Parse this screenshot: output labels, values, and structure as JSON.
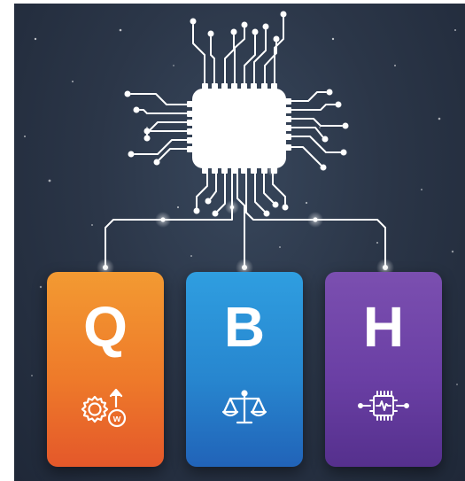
{
  "cards": [
    {
      "letter": "Q",
      "icon": "gear-upload-w-icon",
      "color": "#ee7a2a"
    },
    {
      "letter": "B",
      "icon": "balance-scale-icon",
      "color": "#2786cf"
    },
    {
      "letter": "H",
      "icon": "chip-pulse-icon",
      "color": "#6a3fa4"
    }
  ],
  "icon_texts": {
    "w_badge": "w"
  },
  "colors": {
    "background": "#2b3648",
    "circuit_line": "#ffffff",
    "chip": "#ffffff"
  }
}
